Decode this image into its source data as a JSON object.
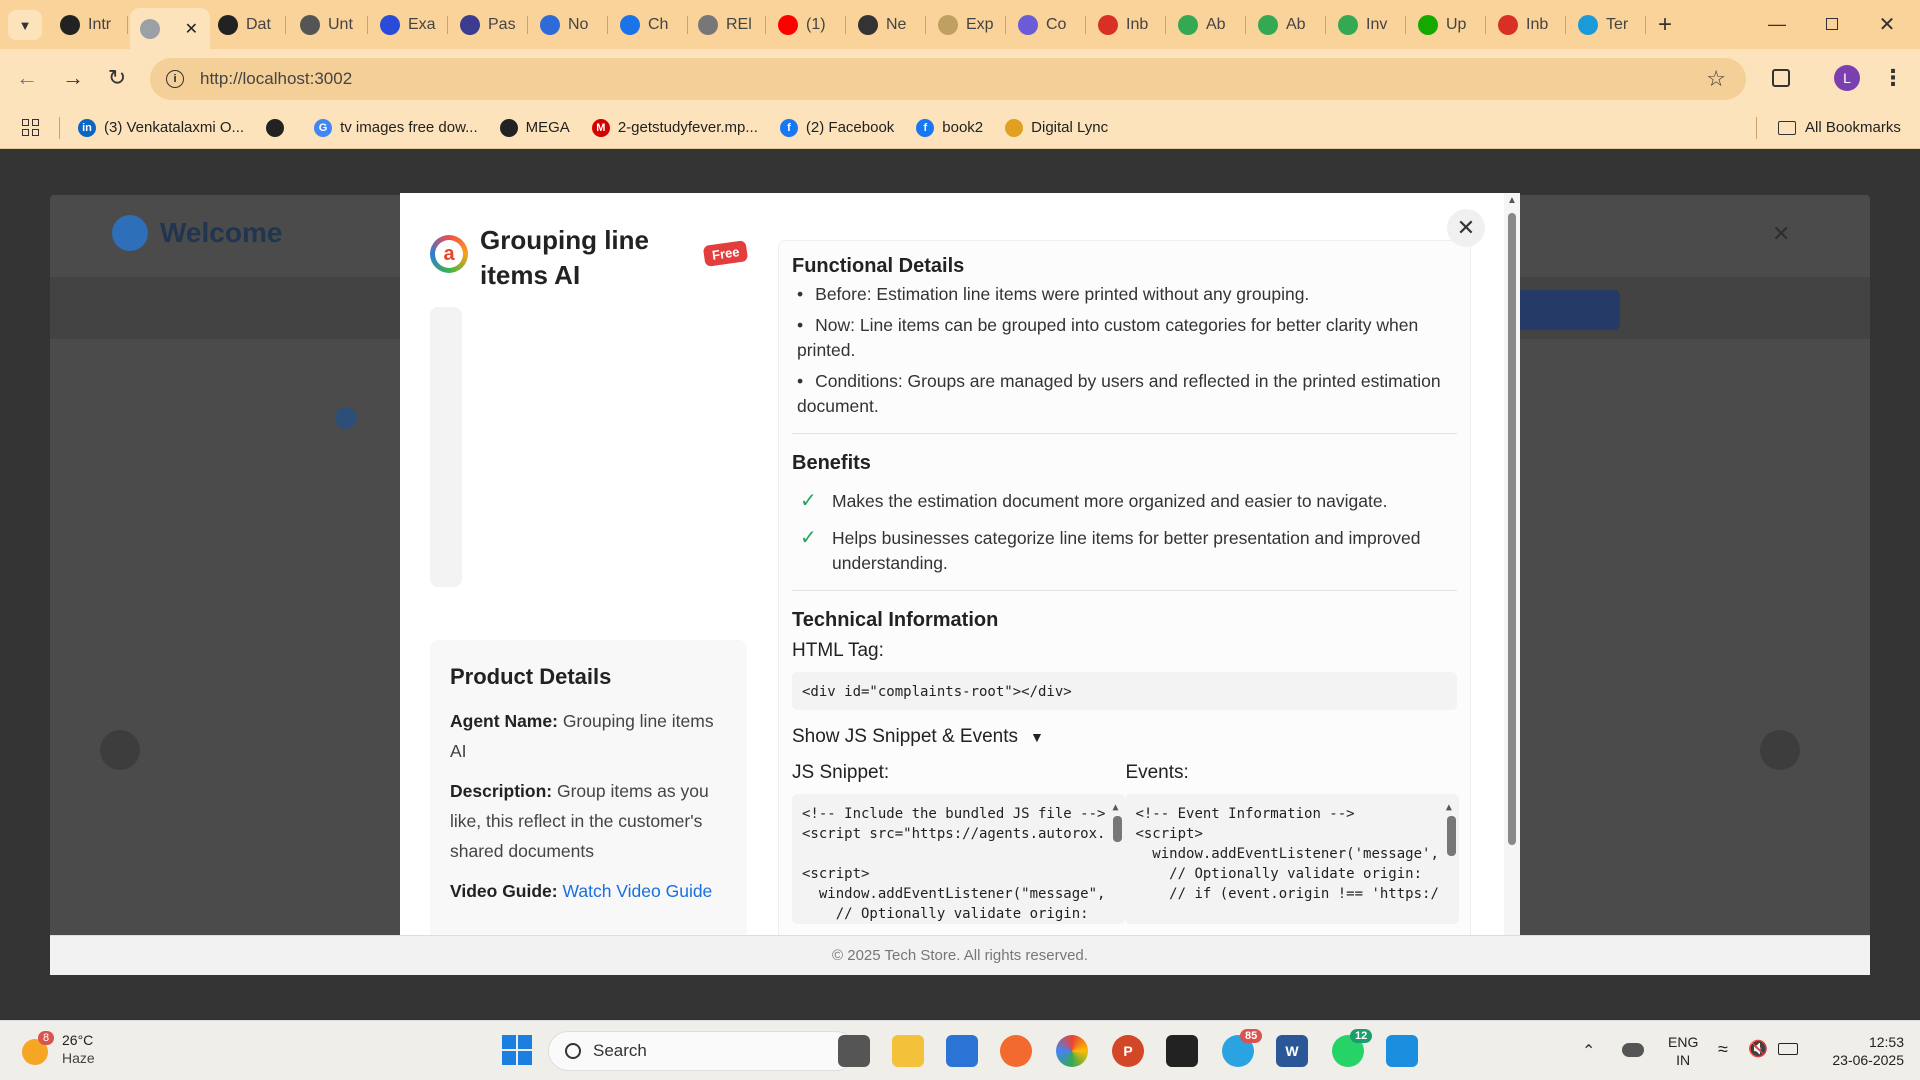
{
  "browser": {
    "tabs": [
      {
        "label": "Intr",
        "icon": "chatgpt-icon",
        "color": "#222222"
      },
      {
        "label": "",
        "icon": "globe-icon",
        "color": "#9aa0a6",
        "active": true
      },
      {
        "label": "Dat",
        "icon": "chatgpt-icon",
        "color": "#222222"
      },
      {
        "label": "Unt",
        "icon": "folder-icon",
        "color": "#555555"
      },
      {
        "label": "Exa",
        "icon": "app-icon",
        "color": "#2a4bd7"
      },
      {
        "label": "Pas",
        "icon": "app-icon",
        "color": "#3b3b8f"
      },
      {
        "label": "No",
        "icon": "app-icon",
        "color": "#2f6bd8"
      },
      {
        "label": "Ch",
        "icon": "app-icon",
        "color": "#1a73e8"
      },
      {
        "label": "REl",
        "icon": "app-icon",
        "color": "#777777"
      },
      {
        "label": "(1)",
        "icon": "youtube-icon",
        "color": "#ff0000"
      },
      {
        "label": "Ne",
        "icon": "app-icon",
        "color": "#333333"
      },
      {
        "label": "Exp",
        "icon": "app-icon",
        "color": "#c0a060"
      },
      {
        "label": "Co",
        "icon": "app-icon",
        "color": "#6b5bd6"
      },
      {
        "label": "Inb",
        "icon": "gmail-icon",
        "color": "#d93025"
      },
      {
        "label": "Ab",
        "icon": "app-icon",
        "color": "#34a853"
      },
      {
        "label": "Ab",
        "icon": "app-icon",
        "color": "#34a853"
      },
      {
        "label": "Inv",
        "icon": "app-icon",
        "color": "#34a853"
      },
      {
        "label": "Up",
        "icon": "upwork-icon",
        "color": "#14a800"
      },
      {
        "label": "Inb",
        "icon": "gmail-icon",
        "color": "#d93025"
      },
      {
        "label": "Ter",
        "icon": "app-icon",
        "color": "#1a9bd7"
      }
    ],
    "url": "http://localhost:3002",
    "profile_initial": "L",
    "bookmarks": [
      {
        "label": "(3) Venkatalaxmi O...",
        "color": "#0a66c2",
        "glyph": "in"
      },
      {
        "label": "",
        "color": "#222222",
        "glyph": ""
      },
      {
        "label": "tv images free dow...",
        "color": "#4285f4",
        "glyph": "G"
      },
      {
        "label": "MEGA",
        "color": "#222222",
        "glyph": ""
      },
      {
        "label": "2-getstudyfever.mp...",
        "color": "#d50000",
        "glyph": "M"
      },
      {
        "label": "(2) Facebook",
        "color": "#1877f2",
        "glyph": "f"
      },
      {
        "label": "book2",
        "color": "#1877f2",
        "glyph": "f"
      },
      {
        "label": "Digital Lync",
        "color": "#e0a020",
        "glyph": ""
      }
    ],
    "all_bookmarks": "All Bookmarks"
  },
  "page": {
    "bg_welcome": "Welcome",
    "footer": "© 2025 Tech Store. All rights reserved."
  },
  "modal": {
    "title": "Grouping line items AI",
    "badge": "Free",
    "product_details": {
      "heading": "Product Details",
      "agent_name_label": "Agent Name:",
      "agent_name": "Grouping line items AI",
      "description_label": "Description:",
      "description": "Group items as you like, this reflect in the customer's shared documents",
      "video_label": "Video Guide:",
      "video_link": "Watch Video Guide"
    },
    "functional": {
      "heading": "Functional Details",
      "items": [
        "Before: Estimation line items were printed without any grouping.",
        "Now: Line items can be grouped into custom categories for better clarity when printed.",
        "Conditions: Groups are managed by users and reflected in the printed estimation document."
      ]
    },
    "benefits": {
      "heading": "Benefits",
      "items": [
        "Makes the estimation document more organized and easier to navigate.",
        "Helps businesses categorize line items for better presentation and improved understanding."
      ]
    },
    "technical": {
      "heading": "Technical Information",
      "html_tag_label": "HTML Tag:",
      "html_tag_code": "<div id=\"complaints-root\"></div>",
      "toggle_label": "Show JS Snippet & Events",
      "js_label": "JS Snippet:",
      "js_code": "<!-- Include the bundled JS file -->\n<script src=\"https://agents.autorox.\n\n<script>\n  window.addEventListener(\"message\",\n    // Optionally validate origin:",
      "events_label": "Events:",
      "events_code": "<!-- Event Information -->\n<script>\n  window.addEventListener('message',\n    // Optionally validate origin:\n    // if (event.origin !== 'https:/"
    }
  },
  "taskbar": {
    "weather_temp": "26°C",
    "weather_desc": "Haze",
    "weather_badge": "8",
    "search": "Search",
    "lang_top": "ENG",
    "lang_bottom": "IN",
    "time": "12:53",
    "date": "23-06-2025",
    "telegram_badge": "85",
    "whatsapp_badge": "12"
  }
}
